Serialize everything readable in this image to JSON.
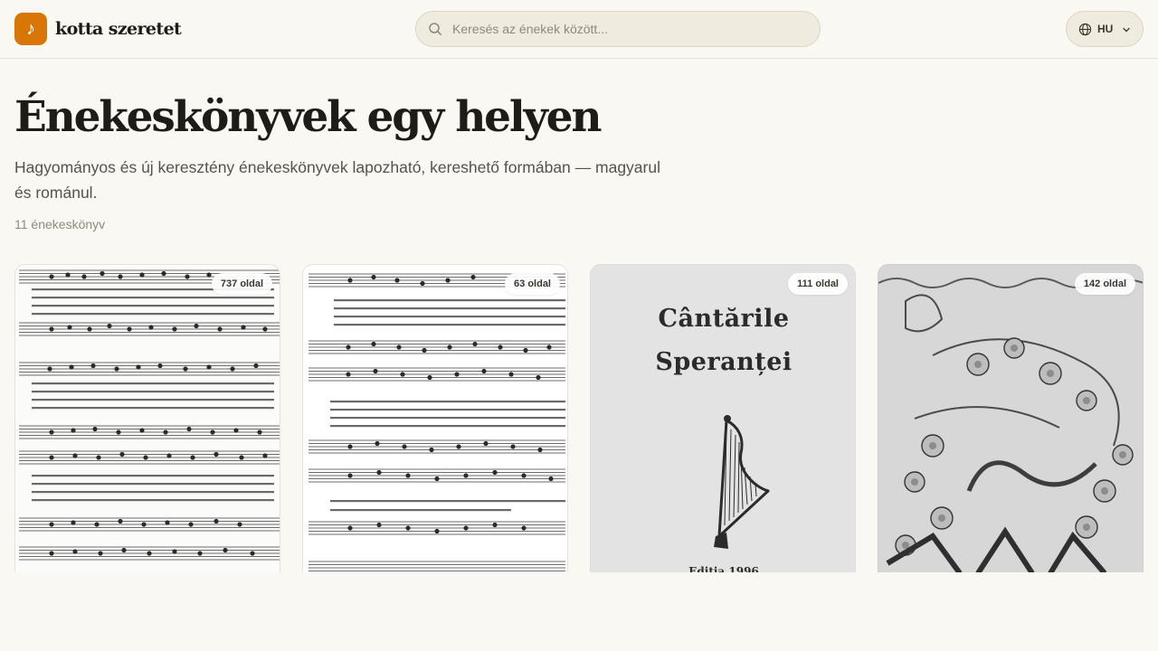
{
  "header": {
    "logo_text": "kotta szeretet",
    "logo_icon": "music-note-icon",
    "search_placeholder": "Keresés az énekek között...",
    "language_code": "HU",
    "accent_color": "#d97706"
  },
  "hero": {
    "title": "Énekeskönyvek egy helyen",
    "subtitle": "Hagyományos és új keresztény énekeskönyvek lapozható, kereshető formában — magyarul és románul.",
    "count_label": "11 énekeskönyv"
  },
  "books": [
    {
      "pages_label": "737 oldal"
    },
    {
      "pages_label": "63 oldal"
    },
    {
      "pages_label": "111 oldal",
      "cover_title_line1": "Cântările",
      "cover_title_line2": "Speranței",
      "cover_edition": "Editia 1996"
    },
    {
      "pages_label": "142 oldal"
    }
  ]
}
